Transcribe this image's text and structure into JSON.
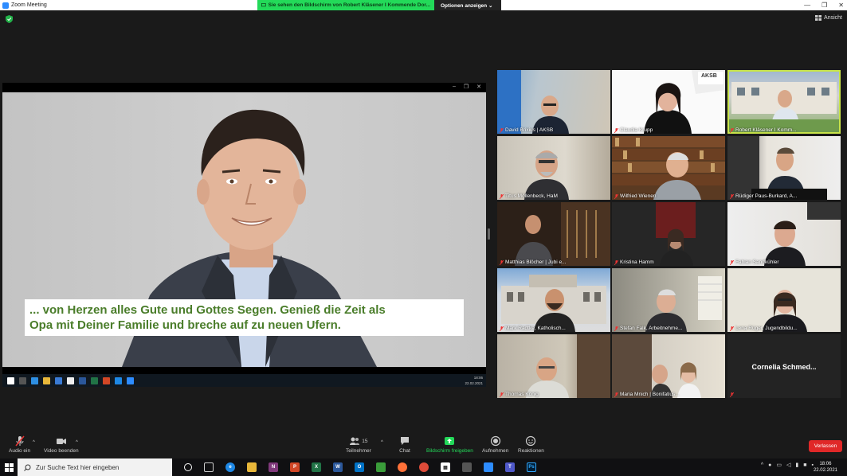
{
  "window": {
    "title": "Zoom Meeting"
  },
  "share_banner": {
    "text": "Sie sehen den Bildschirm von Robert Kläsener I Kommende Dor...",
    "options_label": "Optionen anzeigen ⌄"
  },
  "view_label": "Ansicht",
  "shared_screen": {
    "subtitle_lines": [
      "... von Herzen alles Gute und Gottes Segen. Genieß die Zeit als",
      "Opa mit Deiner Familie und breche auf zu neuen Ufern."
    ],
    "inner_clock_time": "18:06",
    "inner_clock_date": "22.02.2021"
  },
  "participants": [
    {
      "name": "David Brixius | AKSB"
    },
    {
      "name": "Claudia Krupp"
    },
    {
      "name": "Robert Kläsener I Komm..."
    },
    {
      "name": "Titus Möllenbeck, HaM"
    },
    {
      "name": "Wilfried Wienen"
    },
    {
      "name": "Rüdiger Paus-Burkard, A..."
    },
    {
      "name": "Matthias Blöcher | Jubi e..."
    },
    {
      "name": "Kristina Hamm"
    },
    {
      "name": "Fabian Sandkühler"
    },
    {
      "name": "Mark Radtke, Katholisch..."
    },
    {
      "name": "Stefan Falk, Arbeitnehme..."
    },
    {
      "name": "Lena Rüger, Jugendbildu..."
    },
    {
      "name": "Thomas König"
    },
    {
      "name": "Maria Mnich | Bonifatius..."
    },
    {
      "name": "Cornelia  Schmed..."
    }
  ],
  "tile_logo_text": "AKSB",
  "controls": {
    "audio": "Audio ein",
    "video": "Video beenden",
    "participants": "Teilnehmer",
    "participants_count": "15",
    "chat": "Chat",
    "share": "Bildschirm freigeben",
    "record": "Aufnehmen",
    "reactions": "Reaktionen",
    "leave": "Verlassen"
  },
  "taskbar": {
    "search_placeholder": "Zur Suche Text hier eingeben",
    "time": "18:06",
    "date": "22.02.2021"
  },
  "colors": {
    "share_green": "#23d959",
    "subtitle_green": "#4a7d2a",
    "leave_red": "#e02828",
    "active_speaker": "#c8e44a"
  }
}
